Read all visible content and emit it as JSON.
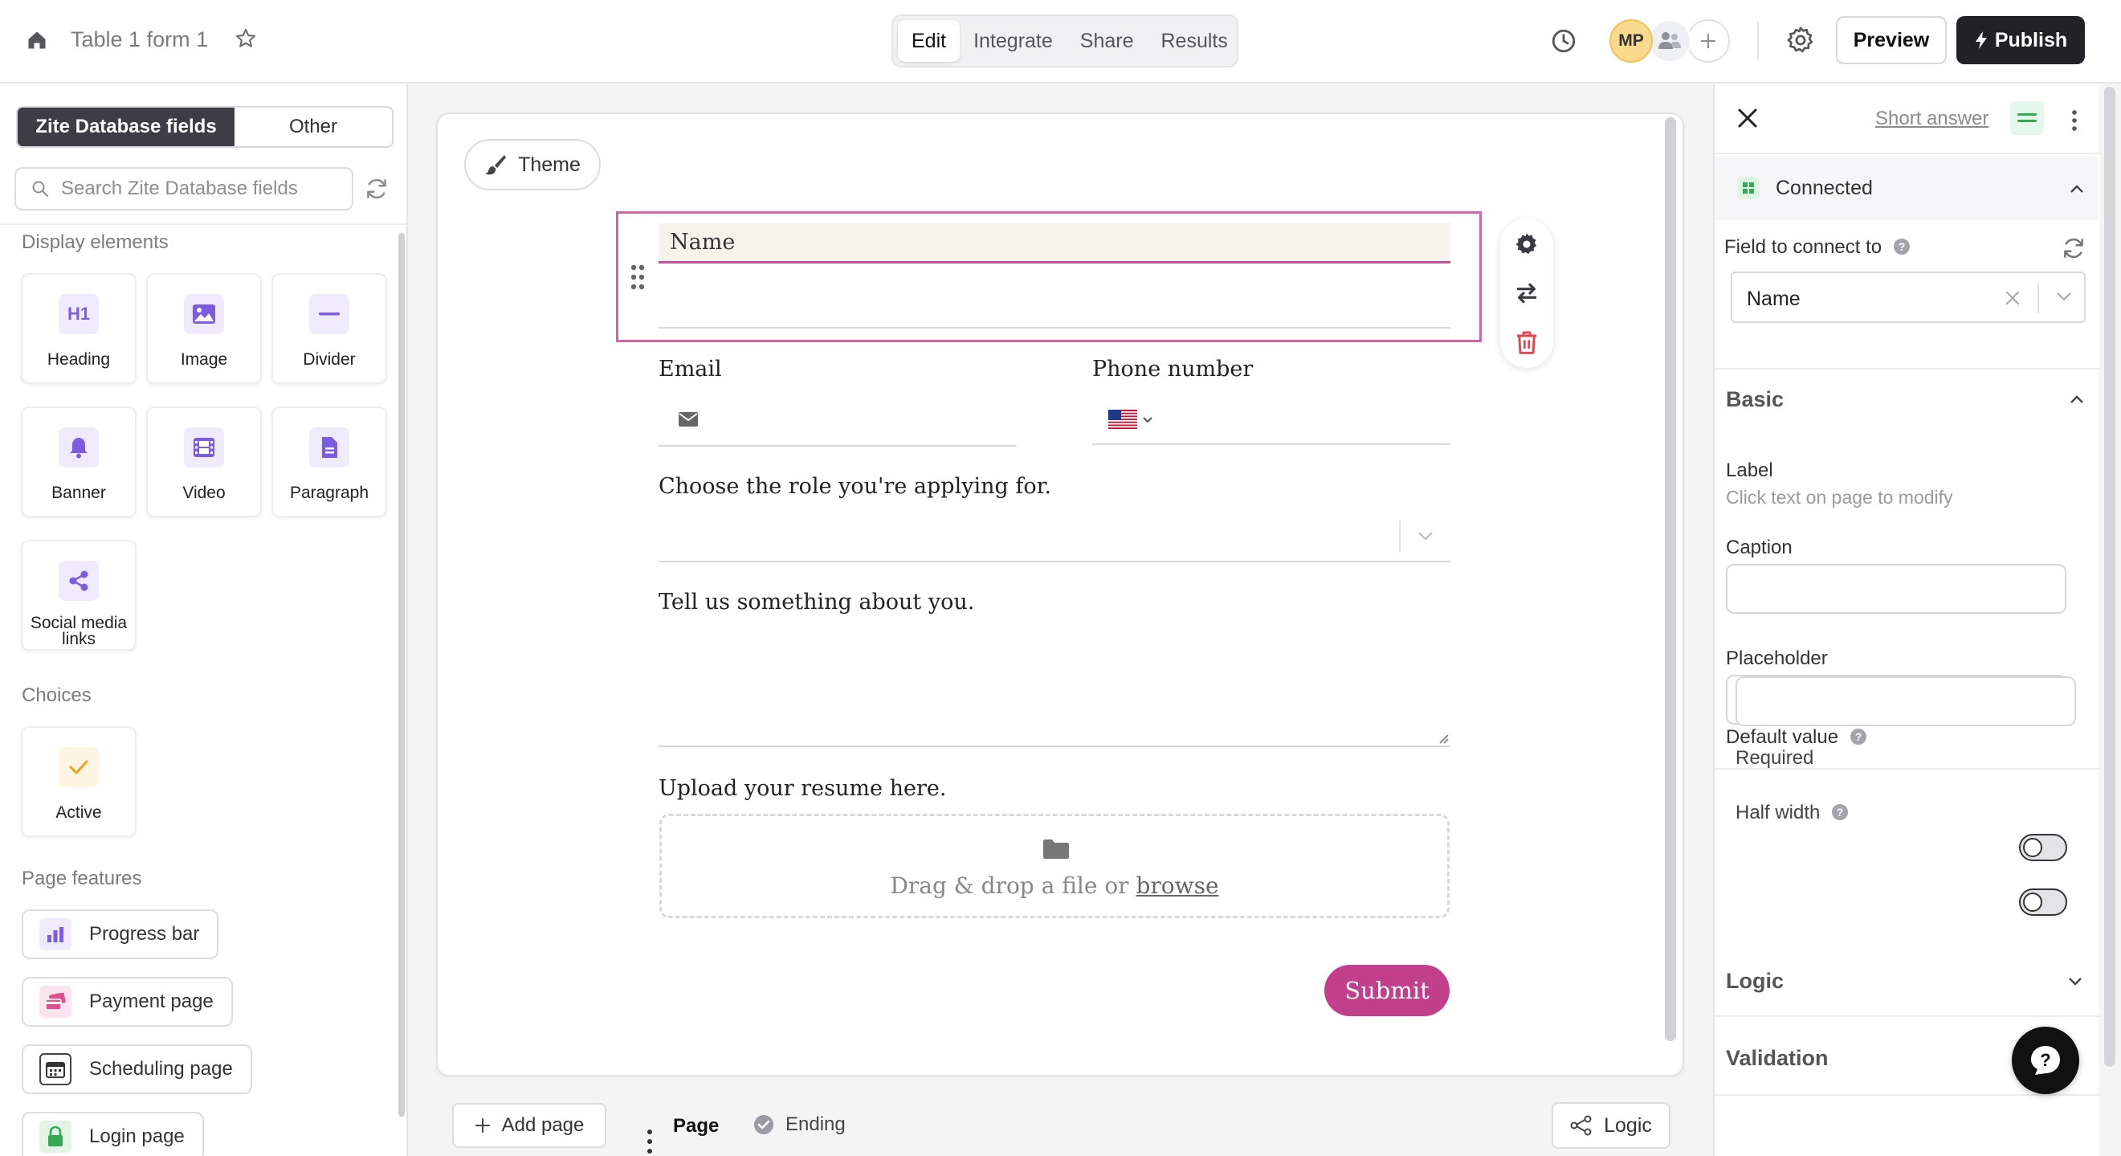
{
  "header": {
    "title": "Table 1 form 1",
    "tabs": [
      "Edit",
      "Integrate",
      "Share",
      "Results"
    ],
    "avatar_initials": "MP",
    "preview_label": "Preview",
    "publish_label": "Publish"
  },
  "sidebar": {
    "source_tabs": [
      "Zite Database fields",
      "Other"
    ],
    "search_placeholder": "Search Zite Database fields",
    "display_title": "Display elements",
    "display_elements": [
      "Heading",
      "Image",
      "Divider",
      "Banner",
      "Video",
      "Paragraph",
      "Social media links"
    ],
    "heading_icon_text": "H1",
    "choices_title": "Choices",
    "choices": [
      "Active"
    ],
    "features_title": "Page features",
    "features": [
      "Progress bar",
      "Payment page",
      "Scheduling page",
      "Login page"
    ]
  },
  "canvas": {
    "theme_label": "Theme",
    "name_label": "Name",
    "email_label": "Email",
    "phone_label": "Phone number",
    "role_label": "Choose the role you're applying for.",
    "about_label": "Tell us something about you.",
    "resume_label": "Upload your resume here.",
    "dropzone_text": "Drag & drop a file or",
    "dropzone_link": "browse",
    "submit_label": "Submit"
  },
  "bottom": {
    "add_page_label": "Add page",
    "page_tab": "Page",
    "ending_tab": "Ending",
    "logic_label": "Logic"
  },
  "panel": {
    "field_type": "Short answer",
    "connected_label": "Connected",
    "field_connect_label": "Field to connect to",
    "field_connect_value": "Name",
    "basic_title": "Basic",
    "label_title": "Label",
    "label_hint": "Click text on page to modify",
    "caption_label": "Caption",
    "placeholder_label": "Placeholder",
    "default_label": "Default value",
    "required_label": "Required",
    "half_width_label": "Half width",
    "required_on": false,
    "half_width_on": false,
    "logic_title": "Logic",
    "validation_title": "Validation"
  },
  "colors": {
    "accent": "#c23f8b",
    "selection": "#d066a4",
    "icon_purple": "#7c5ce0",
    "connected_green": "#34a853"
  }
}
